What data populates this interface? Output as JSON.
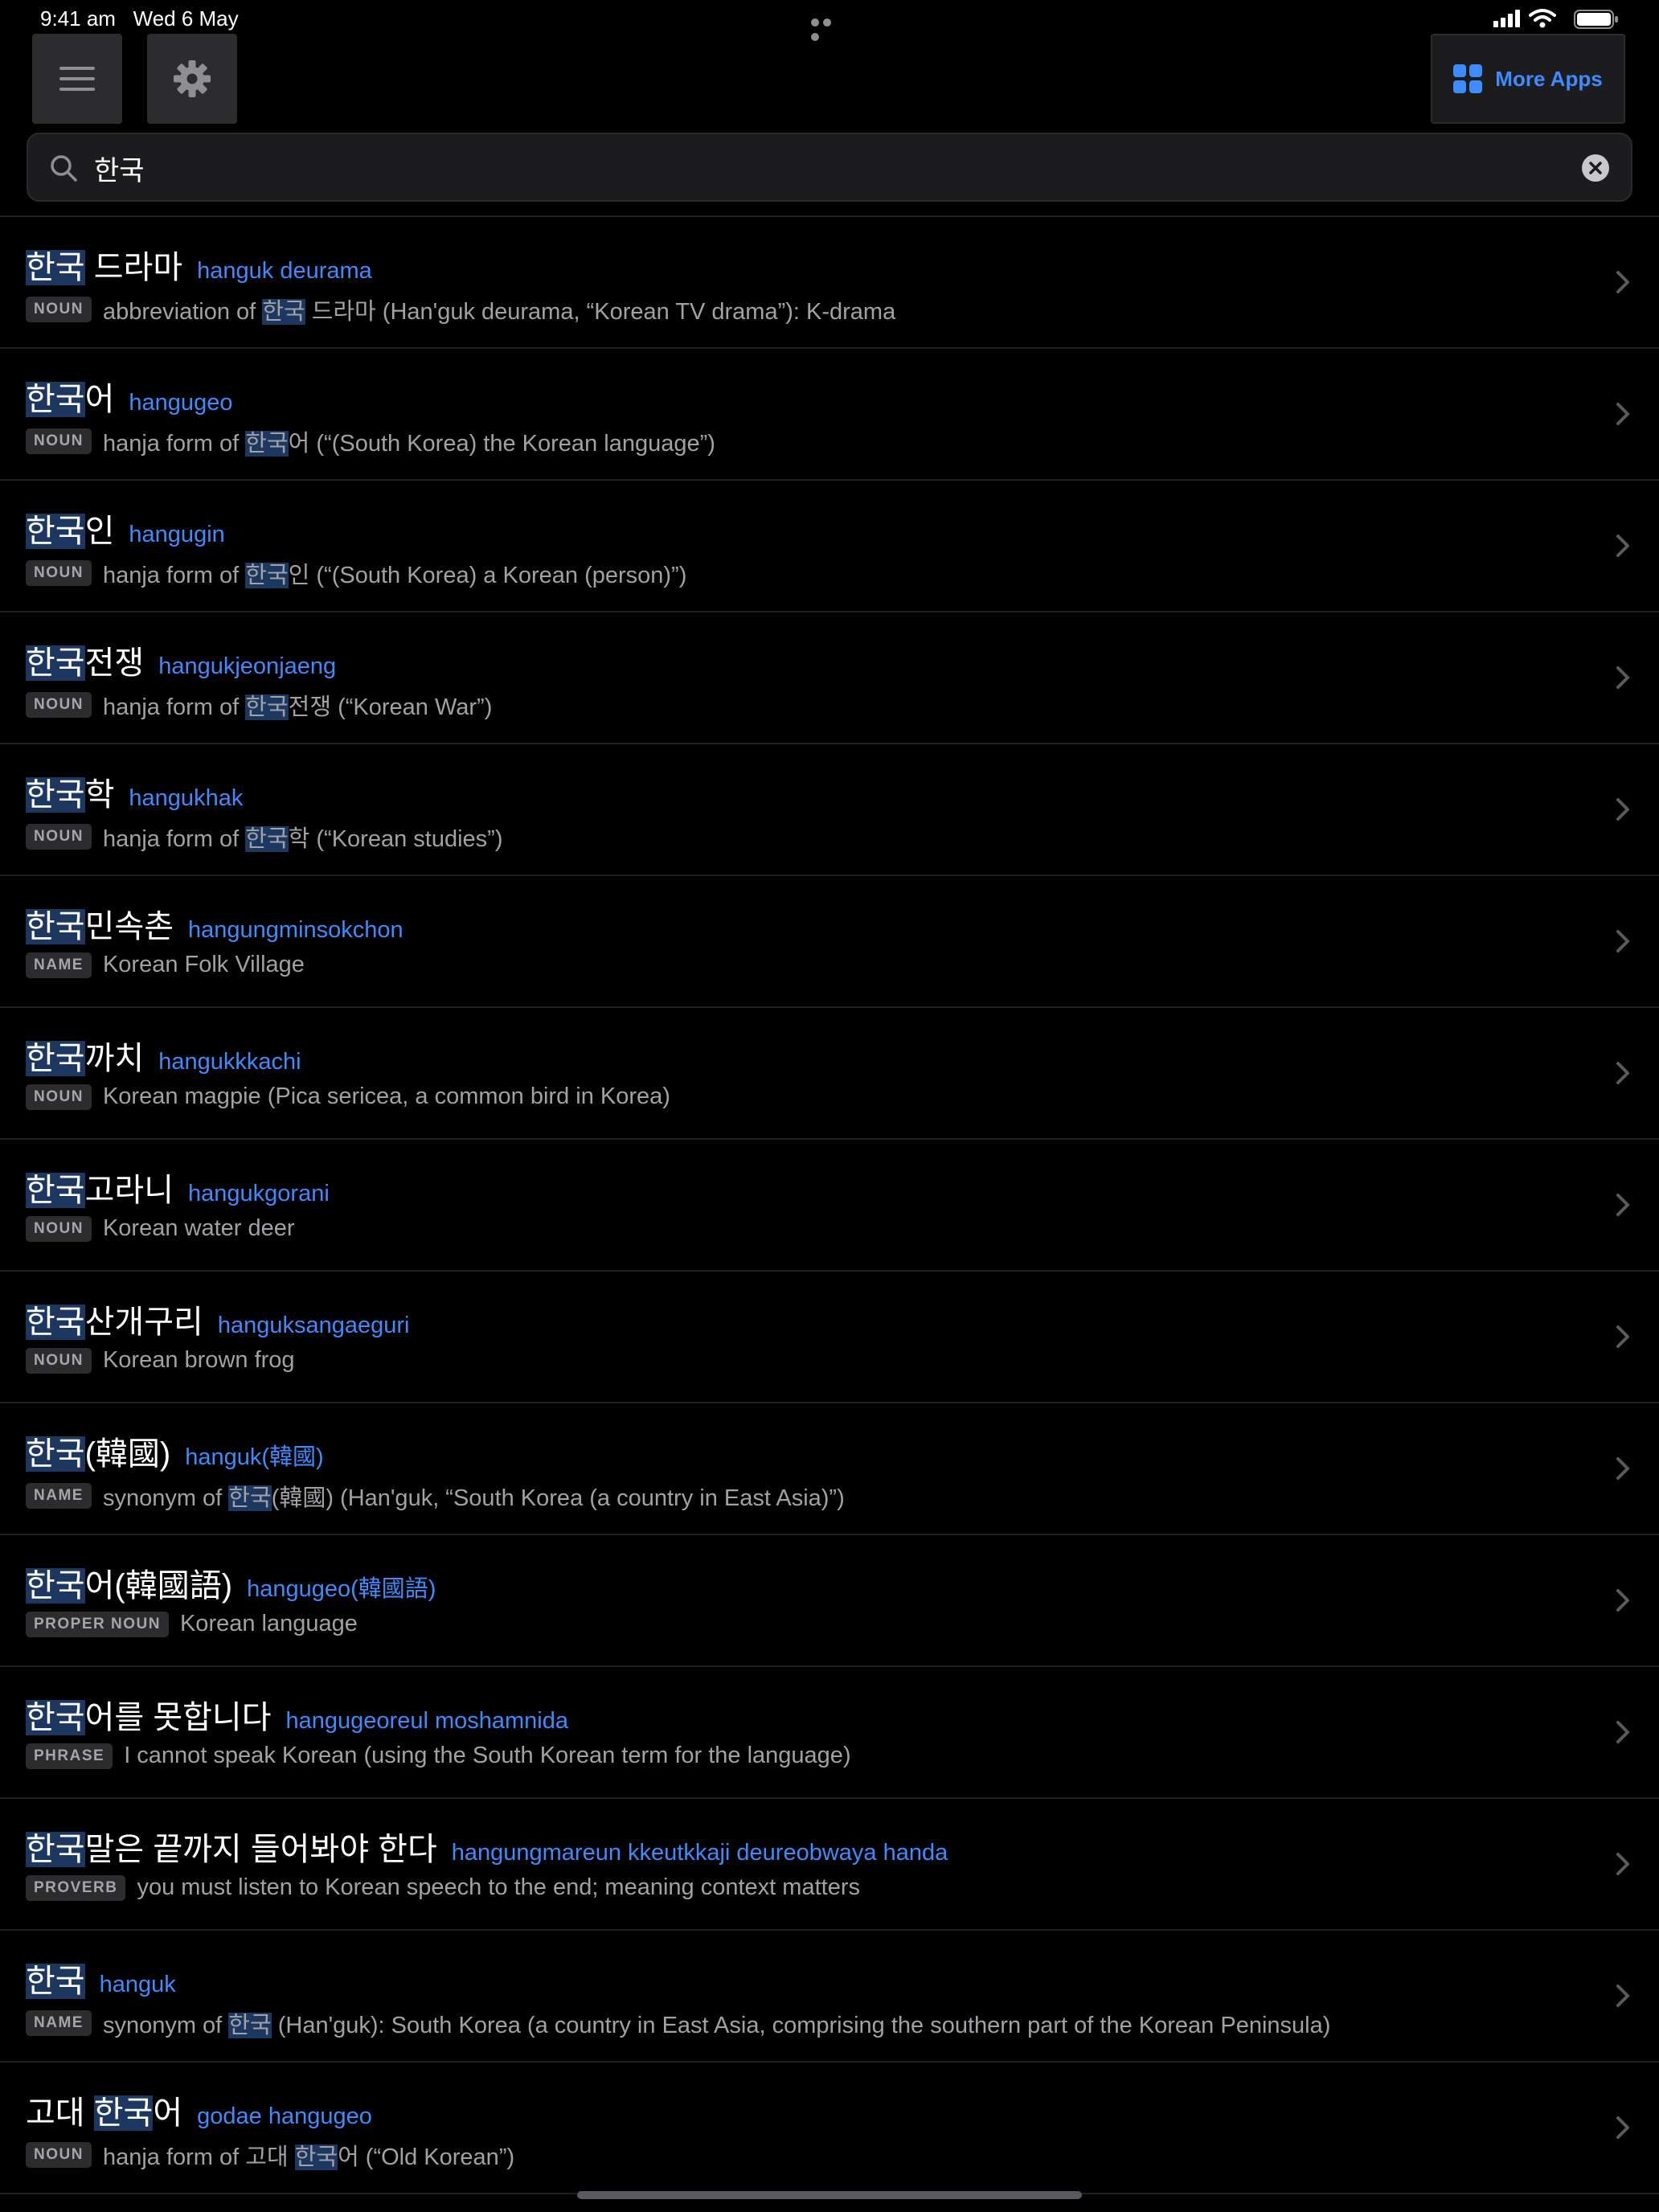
{
  "status_bar": {
    "time": "9:41 am",
    "date": "Wed 6 May"
  },
  "toolbar": {
    "more_apps_label": "More Apps"
  },
  "search": {
    "value": "한국",
    "placeholder": ""
  },
  "results": [
    {
      "hl": "한국",
      "rest": " 드라마",
      "romanization": "hanguk deurama",
      "pos": "NOUN",
      "def_before": "abbreviation of ",
      "def_hl": "한국",
      "def_after": " 드라마 (Han'guk deurama, “Korean TV drama”): K-drama"
    },
    {
      "hl": "한국",
      "rest": "어",
      "romanization": "hangugeo",
      "pos": "NOUN",
      "def_before": "hanja form of ",
      "def_hl": "한국",
      "def_after": "어 (“(South Korea) the Korean language”)"
    },
    {
      "hl": "한국",
      "rest": "인",
      "romanization": "hangugin",
      "pos": "NOUN",
      "def_before": "hanja form of ",
      "def_hl": "한국",
      "def_after": "인 (“(South Korea) a Korean (person)”)"
    },
    {
      "hl": "한국",
      "rest": "전쟁",
      "romanization": "hangukjeonjaeng",
      "pos": "NOUN",
      "def_before": "hanja form of ",
      "def_hl": "한국",
      "def_after": "전쟁 (“Korean War”)"
    },
    {
      "hl": "한국",
      "rest": "학",
      "romanization": "hangukhak",
      "pos": "NOUN",
      "def_before": "hanja form of ",
      "def_hl": "한국",
      "def_after": "학 (“Korean studies”)"
    },
    {
      "hl": "한국",
      "rest": "민속촌",
      "romanization": "hangungminsokchon",
      "pos": "NAME",
      "def_before": "Korean Folk Village",
      "def_hl": "",
      "def_after": ""
    },
    {
      "hl": "한국",
      "rest": "까치",
      "romanization": "hangukkkachi",
      "pos": "NOUN",
      "def_before": "Korean magpie (Pica sericea, a common bird in Korea)",
      "def_hl": "",
      "def_after": ""
    },
    {
      "hl": "한국",
      "rest": "고라니",
      "romanization": "hangukgorani",
      "pos": "NOUN",
      "def_before": "Korean water deer",
      "def_hl": "",
      "def_after": ""
    },
    {
      "hl": "한국",
      "rest": "산개구리",
      "romanization": "hanguksangaeguri",
      "pos": "NOUN",
      "def_before": "Korean brown frog",
      "def_hl": "",
      "def_after": ""
    },
    {
      "hl": "한국",
      "rest": "(韓國)",
      "romanization": "hanguk(韓國)",
      "pos": "NAME",
      "def_before": "synonym of ",
      "def_hl": "한국",
      "def_after": "(韓國) (Han'guk, “South Korea (a country in East Asia)”)"
    },
    {
      "hl": "한국",
      "rest": "어(韓國語)",
      "romanization": "hangugeo(韓國語)",
      "pos": "PROPER NOUN",
      "def_before": "Korean language",
      "def_hl": "",
      "def_after": ""
    },
    {
      "hl": "한국",
      "rest": "어를 못합니다",
      "romanization": "hangugeoreul moshamnida",
      "pos": "PHRASE",
      "def_before": "I cannot speak Korean (using the South Korean term for the language)",
      "def_hl": "",
      "def_after": ""
    },
    {
      "hl": "한국",
      "rest": "말은 끝까지 들어봐야 한다",
      "romanization": "hangungmareun kkeutkkaji deureobwaya handa",
      "pos": "PROVERB",
      "def_before": "you must listen to Korean speech to the end; meaning context matters",
      "def_hl": "",
      "def_after": ""
    },
    {
      "hl": "한국",
      "rest": "",
      "romanization": "hanguk",
      "pos": "NAME",
      "def_before": "synonym of ",
      "def_hl": "한국",
      "def_after": " (Han'guk): South Korea (a country in East Asia, comprising the southern part of the Korean Peninsula)"
    },
    {
      "pre": "고대 ",
      "hl": "한국",
      "rest": "어",
      "romanization": "godae hangugeo",
      "pos": "NOUN",
      "def_before": "hanja form of 고대 ",
      "def_hl": "한국",
      "def_after": "어 (“Old Korean”)"
    }
  ],
  "colors": {
    "accent": "#3d8bfd",
    "highlight": "#1c3760",
    "background": "#000000"
  },
  "icons": [
    "hamburger-menu-icon",
    "gear-icon",
    "apps-grid-icon",
    "search-icon",
    "clear-icon",
    "chevron-right-icon"
  ]
}
